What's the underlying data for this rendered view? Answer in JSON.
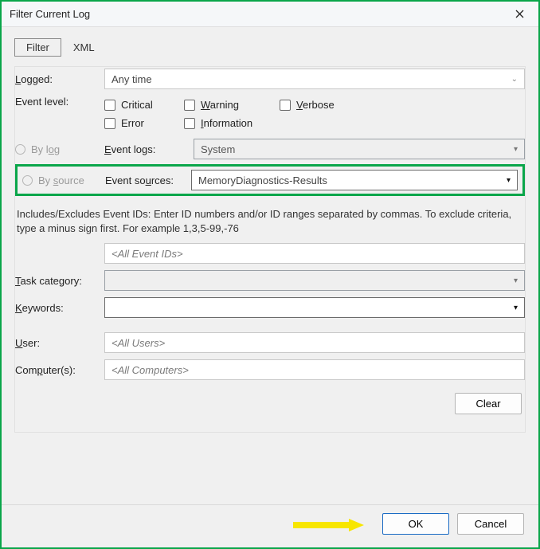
{
  "window": {
    "title": "Filter Current Log"
  },
  "tabs": {
    "filter": "Filter",
    "xml": "XML"
  },
  "labels": {
    "logged": "Logged:",
    "event_level": "Event level:",
    "by_log": "By log",
    "by_source": "By source",
    "event_logs": "Event logs:",
    "event_sources": "Event sources:",
    "task_category": "Task category:",
    "keywords": "Keywords:",
    "user": "User:",
    "computers": "Computer(s):"
  },
  "logged": {
    "value": "Any time"
  },
  "levels": {
    "critical": "Critical",
    "warning": "Warning",
    "verbose": "Verbose",
    "error": "Error",
    "information": "Information"
  },
  "event_logs": {
    "value": "System"
  },
  "event_sources": {
    "value": "MemoryDiagnostics-Results"
  },
  "help_text": "Includes/Excludes Event IDs: Enter ID numbers and/or ID ranges separated by commas. To exclude criteria, type a minus sign first. For example 1,3,5-99,-76",
  "event_ids": {
    "placeholder": "<All Event IDs>"
  },
  "task_category": {
    "value": ""
  },
  "keywords": {
    "value": ""
  },
  "user": {
    "placeholder": "<All Users>"
  },
  "computers": {
    "placeholder": "<All Computers>"
  },
  "buttons": {
    "clear": "Clear",
    "ok": "OK",
    "cancel": "Cancel"
  }
}
